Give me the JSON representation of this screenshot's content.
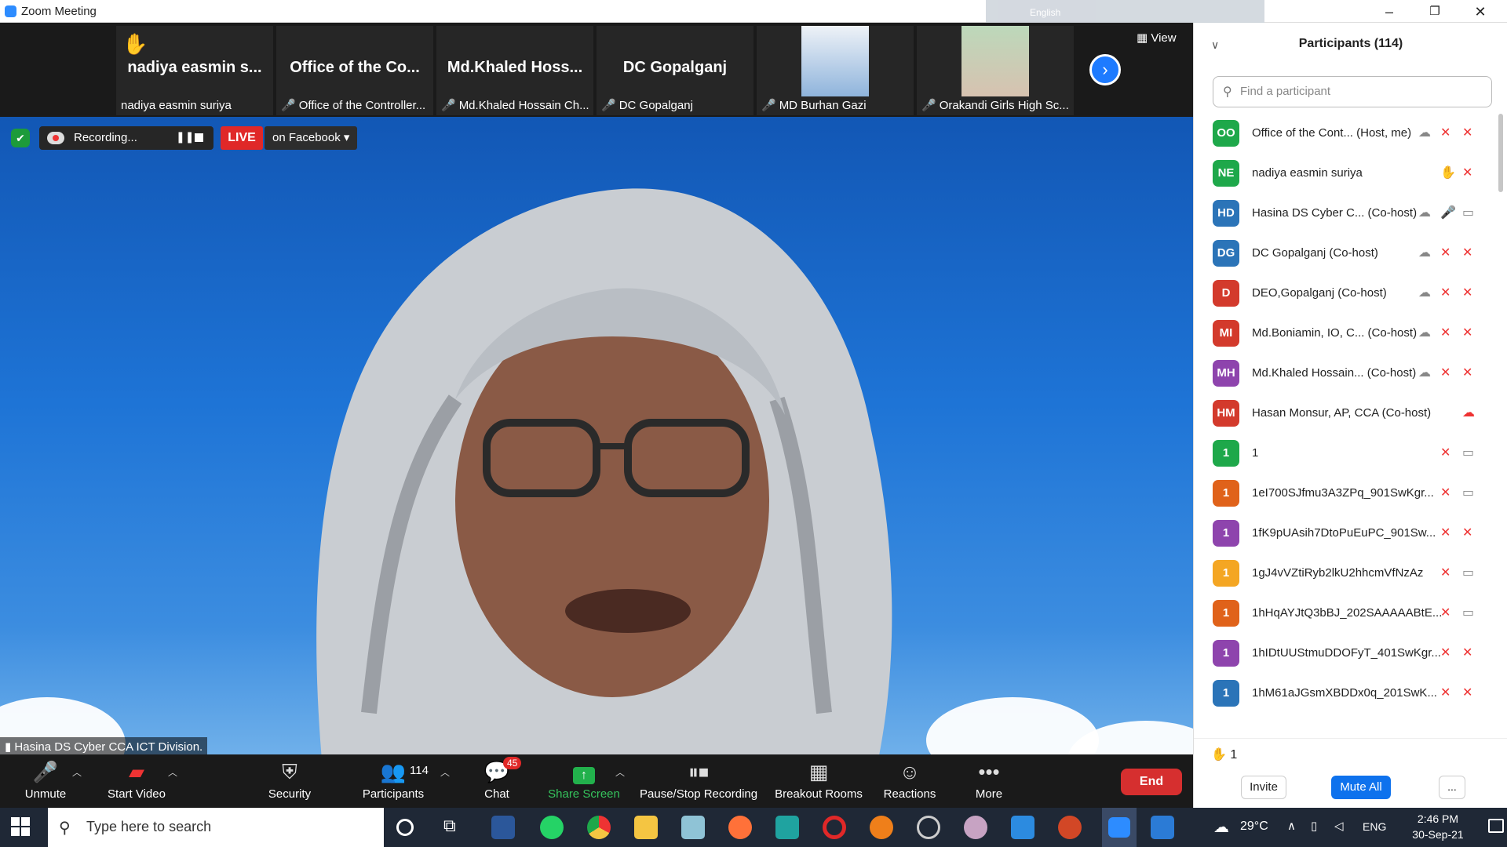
{
  "window": {
    "title": "Zoom Meeting",
    "ime_lang": "English"
  },
  "thumbnails": [
    {
      "big": "nadiya easmin s...",
      "small": "nadiya easmin suriya",
      "hand": true,
      "muted": false
    },
    {
      "big": "Office of the Co...",
      "small": "Office of the Controller...",
      "muted": true
    },
    {
      "big": "Md.Khaled  Hoss...",
      "small": "Md.Khaled Hossain Ch...",
      "muted": true
    },
    {
      "big": "DC Gopalganj",
      "small": "DC Gopalganj",
      "muted": true
    },
    {
      "big": "",
      "small": "MD Burhan Gazi",
      "muted": true,
      "video": true
    },
    {
      "big": "",
      "small": "Orakandi Girls High Sc...",
      "muted": true,
      "video": true
    }
  ],
  "view_label": "View",
  "recording": {
    "label": "Recording...",
    "live": "LIVE",
    "destination": "on Facebook"
  },
  "speaker_name": "Hasina DS Cyber CCA ICT Division.",
  "toolbar": {
    "unmute": "Unmute",
    "start_video": "Start Video",
    "security": "Security",
    "participants": "Participants",
    "participants_count": "114",
    "chat": "Chat",
    "chat_badge": "45",
    "share_screen": "Share Screen",
    "pause_stop": "Pause/Stop Recording",
    "breakout": "Breakout Rooms",
    "reactions": "Reactions",
    "more": "More",
    "end": "End"
  },
  "panel": {
    "title": "Participants (114)",
    "search_placeholder": "Find a participant",
    "participants": [
      {
        "initials": "OO",
        "color": "#1ea84a",
        "name": "Office of the Cont... (Host, me)"
      },
      {
        "initials": "NE",
        "color": "#1ea84a",
        "name": "nadiya easmin suriya"
      },
      {
        "initials": "HD",
        "color": "#2b74b8",
        "name": "Hasina DS Cyber C... (Co-host)"
      },
      {
        "initials": "DG",
        "color": "#2b74b8",
        "name": "DC Gopalganj (Co-host)"
      },
      {
        "initials": "D",
        "color": "#d33a2c",
        "name": "DEO,Gopalganj (Co-host)"
      },
      {
        "initials": "MI",
        "color": "#d33a2c",
        "name": "Md.Boniamin, IO, C... (Co-host)"
      },
      {
        "initials": "MH",
        "color": "#8e44ad",
        "name": "Md.Khaled Hossain... (Co-host)"
      },
      {
        "initials": "HM",
        "color": "#d33a2c",
        "name": "Hasan Monsur, AP, CCA (Co-host)"
      },
      {
        "initials": "1",
        "color": "#1ea84a",
        "name": "1"
      },
      {
        "initials": "1",
        "color": "#e0621a",
        "name": "1eI700SJfmu3A3ZPq_901SwKgr..."
      },
      {
        "initials": "1",
        "color": "#8e44ad",
        "name": "1fK9pUAsih7DtoPuEuPC_901Sw..."
      },
      {
        "initials": "1",
        "color": "#f4a623",
        "name": "1gJ4vVZtiRyb2lkU2hhcmVfNzAz"
      },
      {
        "initials": "1",
        "color": "#e0621a",
        "name": "1hHqAYJtQ3bBJ_202SAAAAABtE..."
      },
      {
        "initials": "1",
        "color": "#8e44ad",
        "name": "1hIDtUUStmuDDOFyT_401SwKgr..."
      },
      {
        "initials": "1",
        "color": "#2b74b8",
        "name": "1hM61aJGsmXBDDx0q_201SwK..."
      }
    ],
    "raised_hands": "1",
    "invite": "Invite",
    "mute_all": "Mute All",
    "more": "..."
  },
  "taskbar": {
    "search_placeholder": "Type here to search",
    "temperature": "29°C",
    "language": "ENG",
    "time": "2:46 PM",
    "date": "30-Sep-21"
  }
}
